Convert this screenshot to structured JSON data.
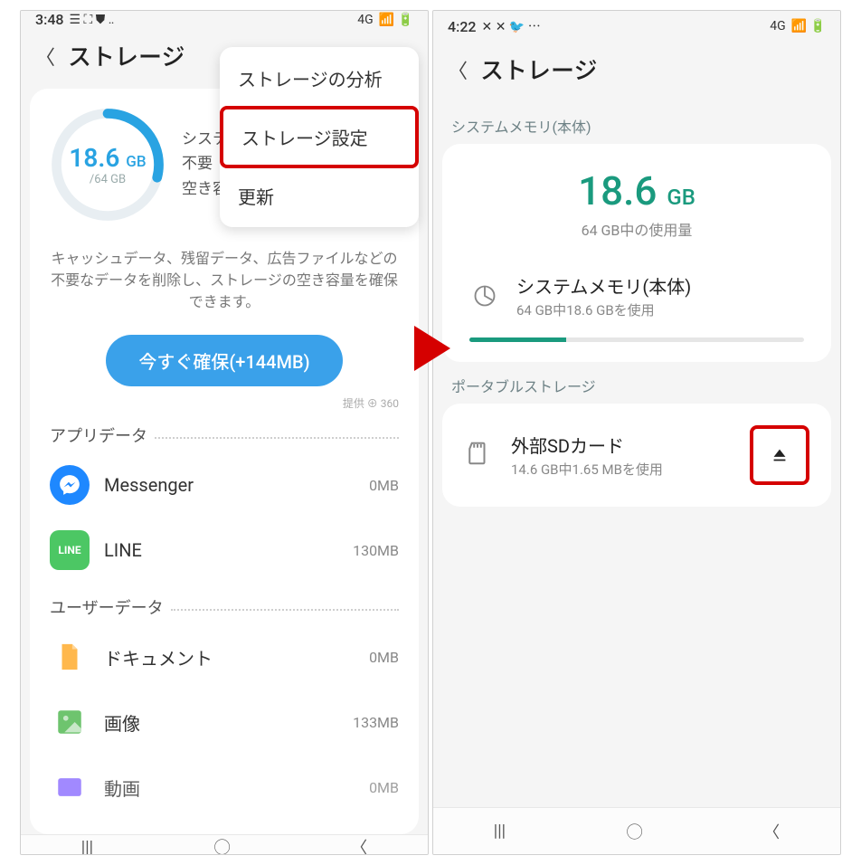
{
  "arrow_color": "#d50000",
  "left": {
    "status": {
      "time": "3:48",
      "net": "4G",
      "icons_left": "☰ ⛶ ⛊ ‥",
      "icons_right": "📶 🔋"
    },
    "header": {
      "title": "ストレージ"
    },
    "donut": {
      "used": "18.6",
      "unit": "GB",
      "total": "/64 GB",
      "percent": 29
    },
    "info": {
      "line1": "システム",
      "line2": "不要",
      "line3": "空き容量"
    },
    "desc": "キャッシュデータ、残留データ、広告ファイルなどの不要なデータを削除し、ストレージの空き容量を確保できます。",
    "cta": "今すぐ確保(+144MB)",
    "provider": "提供 ⊕ 360",
    "menu": {
      "item1": "ストレージの分析",
      "item2": "ストレージ設定",
      "item3": "更新"
    },
    "sections": {
      "appdata": "アプリデータ",
      "userdata": "ユーザーデータ"
    },
    "apps": [
      {
        "name": "Messenger",
        "size": "0MB",
        "color": "#1e88ff",
        "glyph": "✉"
      },
      {
        "name": "LINE",
        "size": "130MB",
        "color": "#4cc764",
        "glyph": "LINE"
      }
    ],
    "user": [
      {
        "name": "ドキュメント",
        "size": "0MB",
        "color": "#ffb84d",
        "glyph": "📄"
      },
      {
        "name": "画像",
        "size": "133MB",
        "color": "#6ec46e",
        "glyph": "🖼"
      },
      {
        "name": "動画",
        "size": "0MB",
        "color": "#8a6cff",
        "glyph": "▶"
      }
    ]
  },
  "right": {
    "status": {
      "time": "4:22",
      "net": "4G",
      "icons_left": "✕ ✕ 🐦 ⋯",
      "icons_right": "📶 🔋"
    },
    "header": {
      "title": "ストレージ"
    },
    "sysmem_label": "システムメモリ(本体)",
    "sysmem": {
      "used": "18.6",
      "unit": "GB",
      "sub": "64 GB中の使用量"
    },
    "sysitem": {
      "title": "システムメモリ(本体)",
      "sub": "64 GB中18.6 GBを使用",
      "percent": 29
    },
    "portable_label": "ポータブルストレージ",
    "sd": {
      "title": "外部SDカード",
      "sub": "14.6 GB中1.65 MBを使用"
    }
  }
}
